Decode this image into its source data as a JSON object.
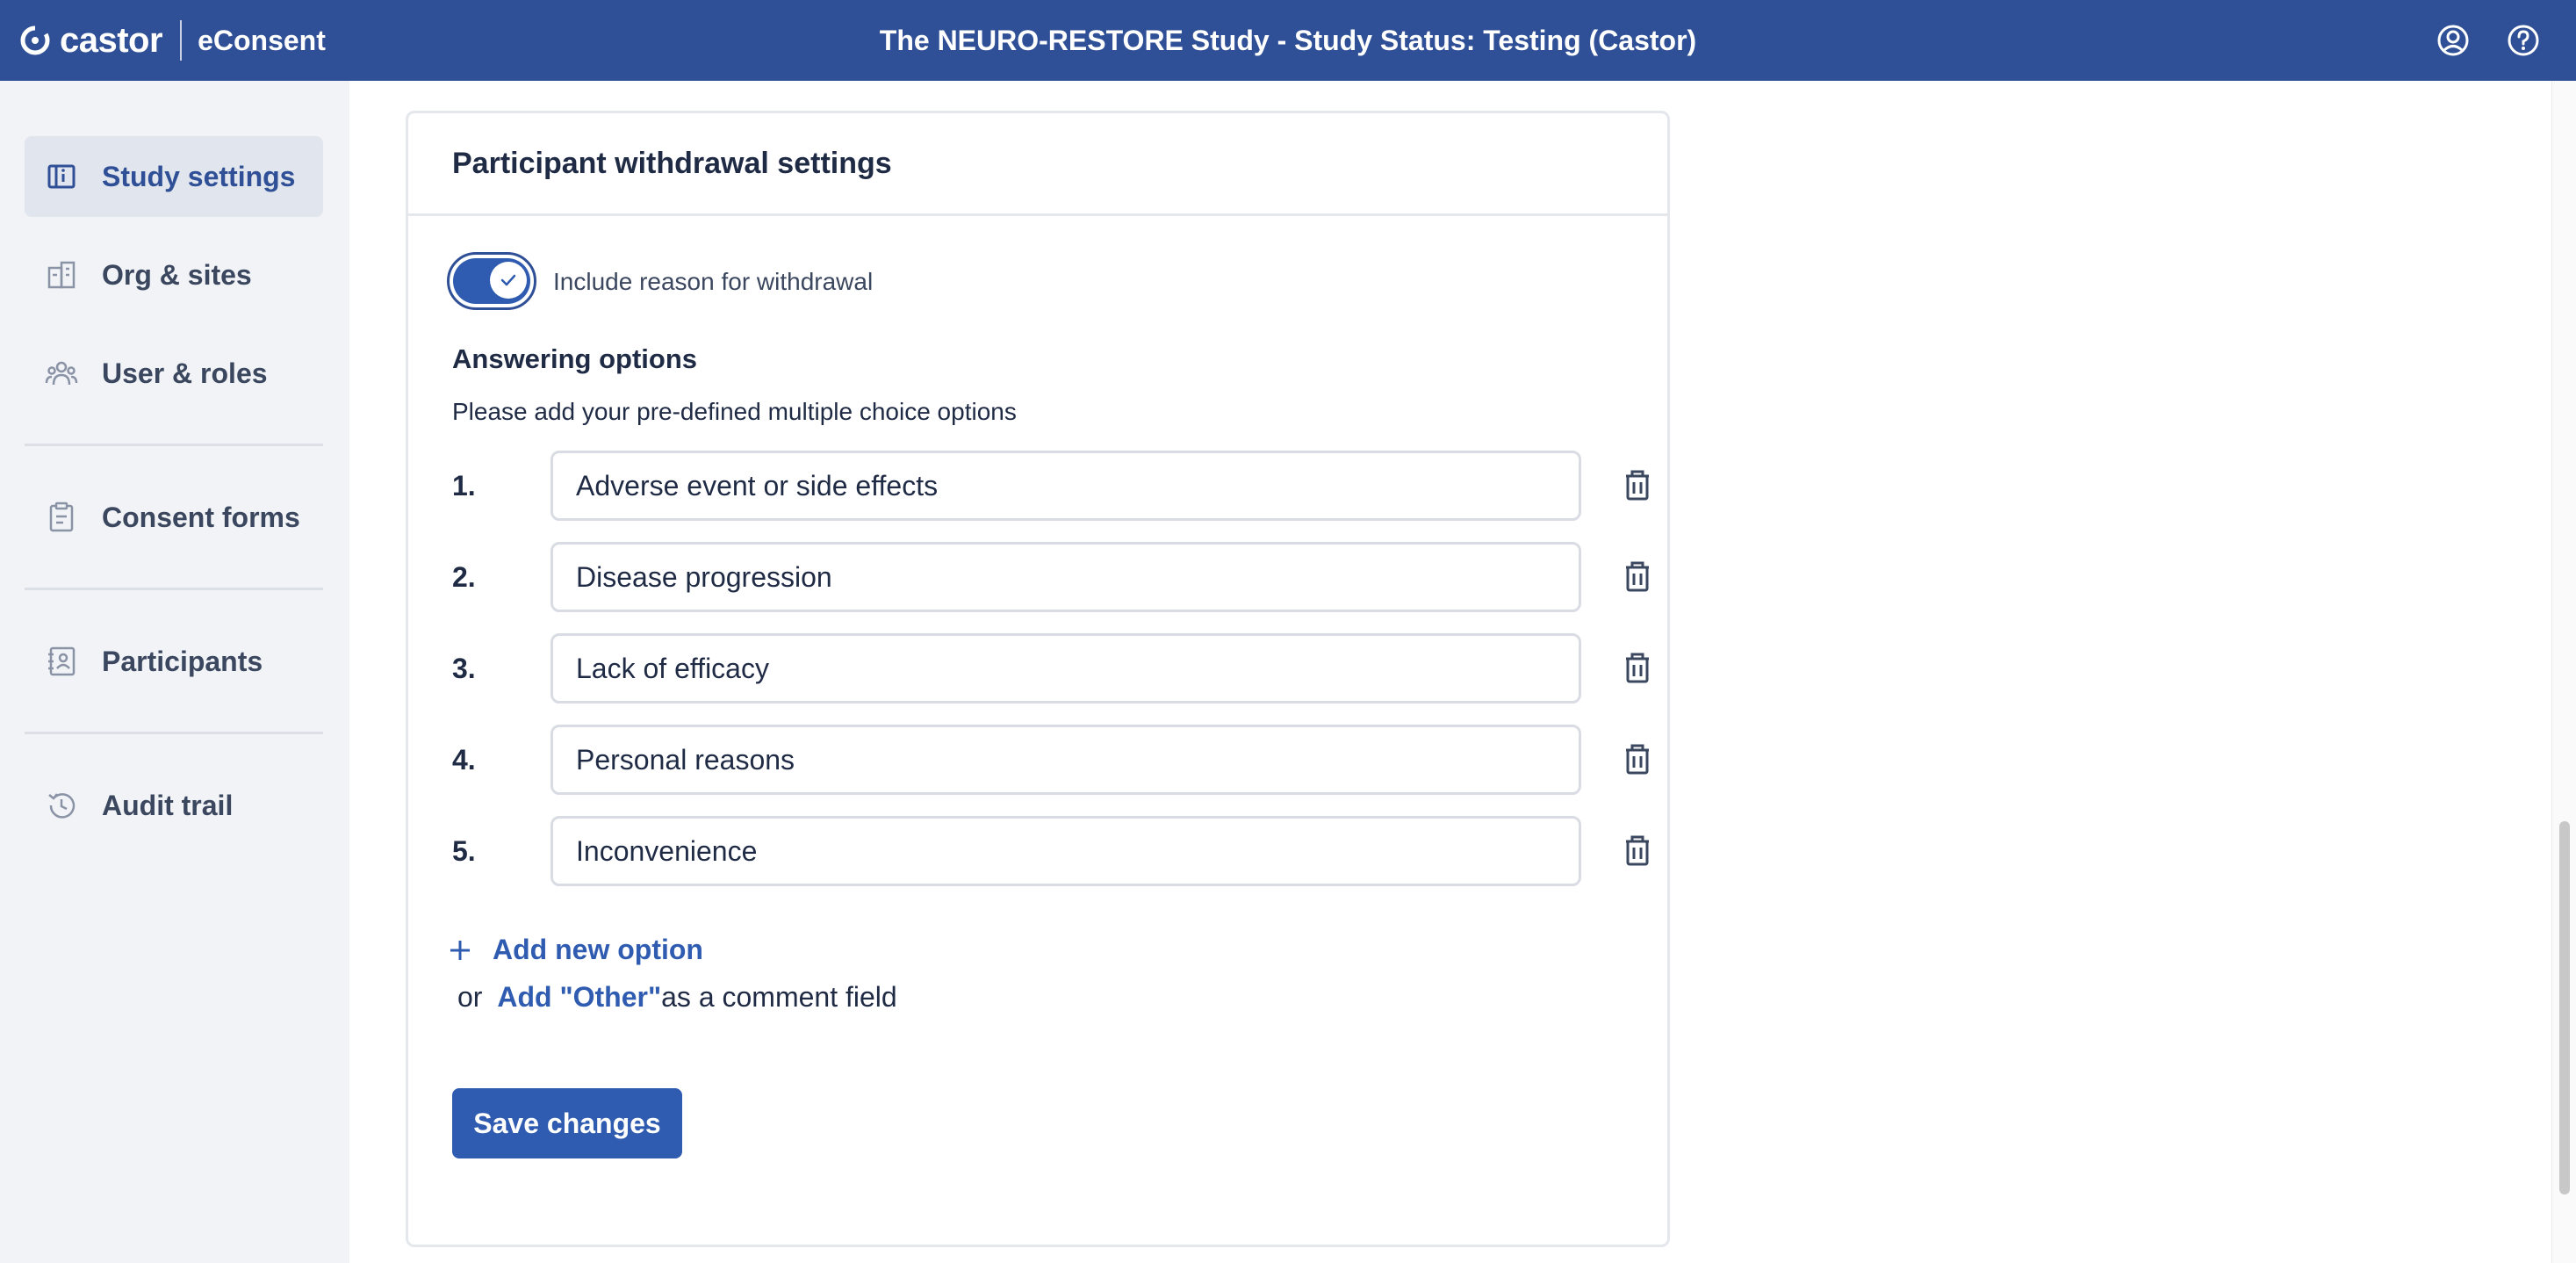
{
  "header": {
    "brand_name": "castor",
    "product_name": "eConsent",
    "title": "The NEURO-RESTORE Study  - Study Status: Testing (Castor)",
    "icons": [
      "user-circle-icon",
      "help-circle-icon"
    ]
  },
  "sidebar": {
    "items": [
      {
        "label": "Study settings",
        "icon": "study-settings-icon",
        "active": true
      },
      {
        "label": "Org & sites",
        "icon": "building-icon",
        "active": false
      },
      {
        "label": "User & roles",
        "icon": "users-icon",
        "active": false
      },
      {
        "label": "Consent forms",
        "icon": "clipboard-icon",
        "active": false
      },
      {
        "label": "Participants",
        "icon": "contact-book-icon",
        "active": false
      },
      {
        "label": "Audit trail",
        "icon": "history-icon",
        "active": false
      }
    ]
  },
  "card": {
    "title": "Participant withdrawal settings",
    "toggle": {
      "label": "Include reason for withdrawal",
      "checked": true
    },
    "answering_heading": "Answering options",
    "answering_sub": "Please add your pre-defined multiple choice options",
    "options": [
      {
        "number": "1.",
        "value": "Adverse event or side effects"
      },
      {
        "number": "2.",
        "value": "Disease progression"
      },
      {
        "number": "3.",
        "value": "Lack of efficacy"
      },
      {
        "number": "4.",
        "value": "Personal reasons"
      },
      {
        "number": "5.",
        "value": "Inconvenience"
      }
    ],
    "add_option_label": "Add new option",
    "other_prefix": "or",
    "other_link": "Add \"Other\"",
    "other_suffix": "as a comment field",
    "save_label": "Save changes"
  },
  "colors": {
    "primary": "#2f5cb0",
    "header_bg": "#2f4f96",
    "sidebar_bg": "#f1f3f6"
  }
}
